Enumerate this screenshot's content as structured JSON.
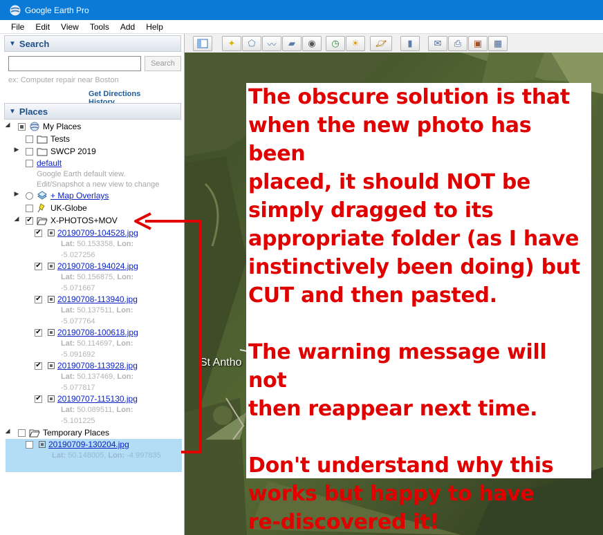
{
  "window": {
    "title": "Google Earth Pro"
  },
  "menu": [
    "File",
    "Edit",
    "View",
    "Tools",
    "Add",
    "Help"
  ],
  "search": {
    "header": "Search",
    "placeholder": "ex: Computer repair near Boston",
    "button": "Search",
    "get_directions": "Get Directions",
    "history": "History"
  },
  "places": {
    "header": "Places",
    "my_places": "My Places",
    "tests": "Tests",
    "swcp": "SWCP 2019",
    "default_link": "default",
    "default_desc1": "Google Earth default view.",
    "default_desc2": "Edit/Snapshot a new view to change",
    "map_overlays": "+ Map Overlays",
    "uk_globe": "UK-Globe",
    "x_photos": "X-PHOTOS+MOV",
    "photos": [
      {
        "name": "20190709-104528.jpg",
        "lat_label": "Lat:",
        "lat": "50.153358,",
        "lon_label": "Lon:",
        "lon": "-5.027256"
      },
      {
        "name": "20190708-194024.jpg",
        "lat_label": "Lat:",
        "lat": "50.156875,",
        "lon_label": "Lon:",
        "lon": "-5.071667"
      },
      {
        "name": "20190708-113940.jpg",
        "lat_label": "Lat:",
        "lat": "50.137511,",
        "lon_label": "Lon:",
        "lon": "-5.077764"
      },
      {
        "name": "20190708-100618.jpg",
        "lat_label": "Lat:",
        "lat": "50.114697,",
        "lon_label": "Lon:",
        "lon": "-5.091692"
      },
      {
        "name": "20190708-113928.jpg",
        "lat_label": "Lat:",
        "lat": "50.137469,",
        "lon_label": "Lon:",
        "lon": "-5.077817"
      },
      {
        "name": "20190707-115130.jpg",
        "lat_label": "Lat:",
        "lat": "50.089511,",
        "lon_label": "Lon:",
        "lon": "-5.101225"
      }
    ],
    "temporary": "Temporary Places",
    "temp_photo": {
      "name": "20190709-130204.jpg",
      "lat_label": "Lat:",
      "lat": "50.148005,",
      "lon_label": "Lon:",
      "lon": "-4.997835"
    }
  },
  "map": {
    "place_label": "St Antho"
  },
  "annotation": {
    "para1": [
      "The obscure solution is that",
      "when the new photo has been",
      "placed, it should NOT be",
      "simply dragged to its",
      "appropriate folder (as I have",
      "instinctively been doing) but",
      "CUT and then pasted."
    ],
    "para2": [
      "The warning message will not",
      "then reappear next time."
    ],
    "para3": [
      "Don't understand why this",
      "works but happy to have",
      "re-discovered it!"
    ]
  },
  "colors": {
    "title_bar": "#0b79d6",
    "annotation_text": "#e10000",
    "arrow": "#e10000",
    "selection": "#b3dcf7"
  }
}
